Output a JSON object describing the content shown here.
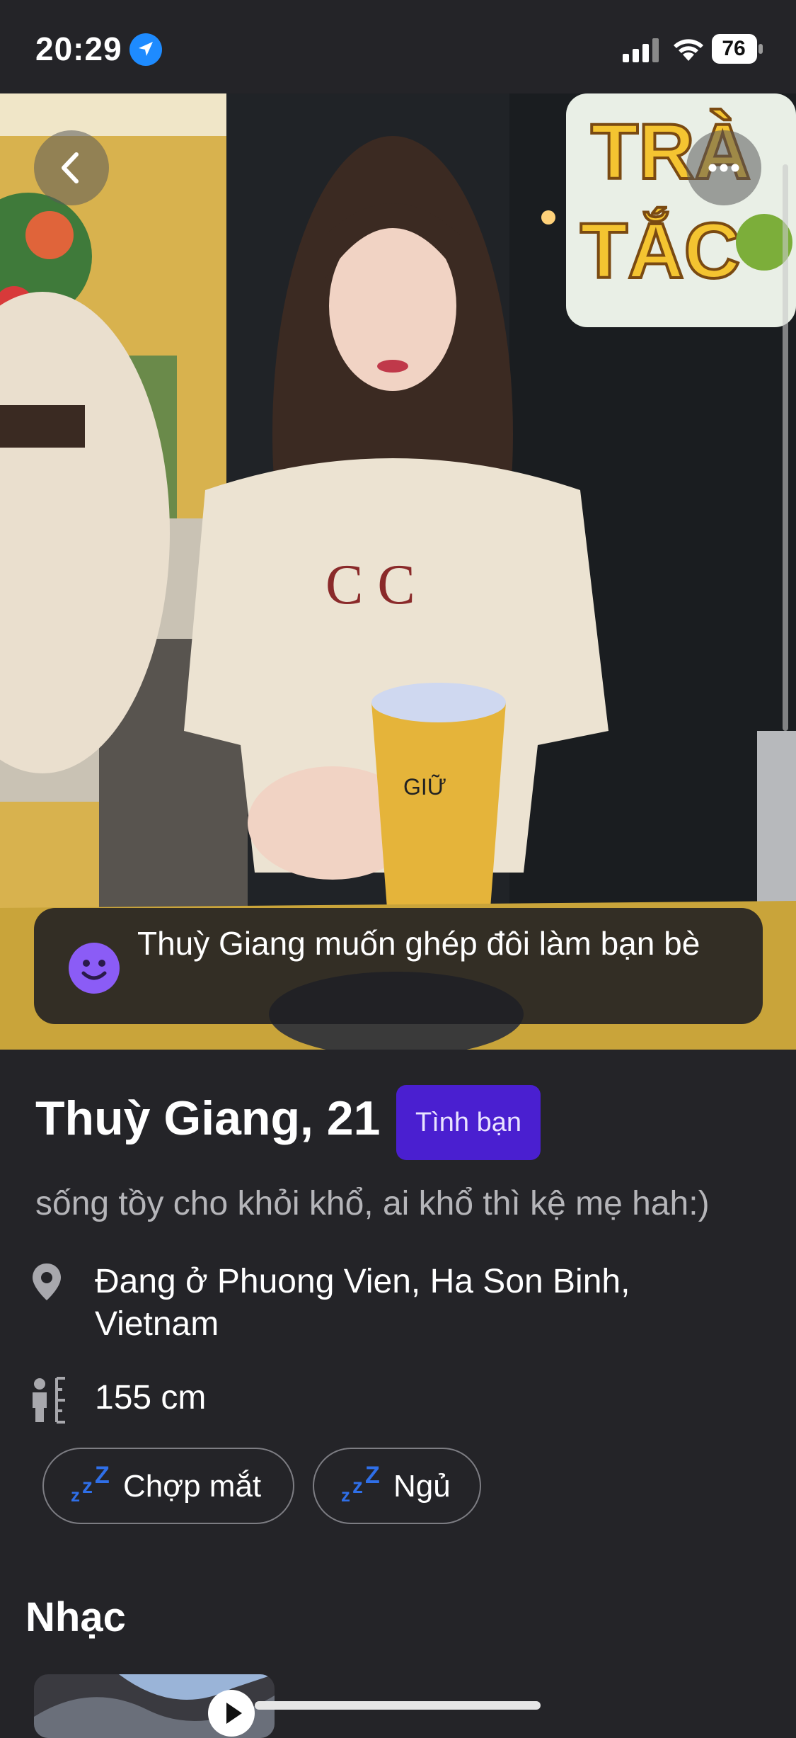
{
  "status_bar": {
    "time": "20:29",
    "battery": "76"
  },
  "photo": {
    "match_text": "Thuỳ Giang muốn ghép đôi làm bạn bè",
    "sign_text": "TRÀ TẮC"
  },
  "profile": {
    "name_age": "Thuỳ Giang, 21",
    "badge": "Tình bạn",
    "bio": "sống tồy cho khỏi khổ, ai khổ thì kệ mẹ hah:)",
    "location": "Đang ở Phuong Vien, Ha Son Binh, Vietnam",
    "height": "155 cm",
    "habits": [
      {
        "label": "Chợp mắt",
        "icon": "zzz-icon"
      },
      {
        "label": "Ngủ",
        "icon": "zzz-icon"
      }
    ]
  },
  "music": {
    "title": "Nhạc"
  },
  "colors": {
    "accent": "#4a1fd0",
    "background": "#242428",
    "emoji": "#8b5cf6",
    "zzz": "#2f6fe8"
  }
}
